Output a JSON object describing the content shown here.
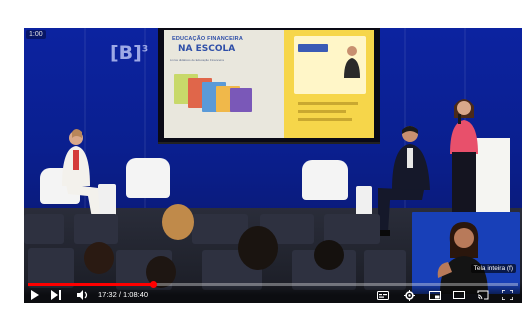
{
  "player": {
    "corner_time": "1:00",
    "current_time": "17:32",
    "duration": "1:08:40",
    "time_separator": " / ",
    "progress_fraction": 0.255,
    "progress_color": "#ff0000",
    "tooltip": "Tela inteira (f)"
  },
  "stage": {
    "logo_text": "[B]",
    "logo_sup": "3"
  },
  "slide": {
    "line1": "EDUCAÇÃO FINANCEIRA",
    "line2": "NA ESCOLA",
    "subtitle": "Livros didáticos de Educação Financeira"
  },
  "colors": {
    "stage_blue": "#0c23a0",
    "slide_yellow": "#f6d64a",
    "speaker_shirt": "#e8506b"
  },
  "icons": [
    "play-icon",
    "next-icon",
    "volume-icon",
    "settings-icon",
    "subtitles-icon",
    "miniplayer-icon",
    "theater-icon",
    "cast-icon",
    "fullscreen-icon"
  ]
}
